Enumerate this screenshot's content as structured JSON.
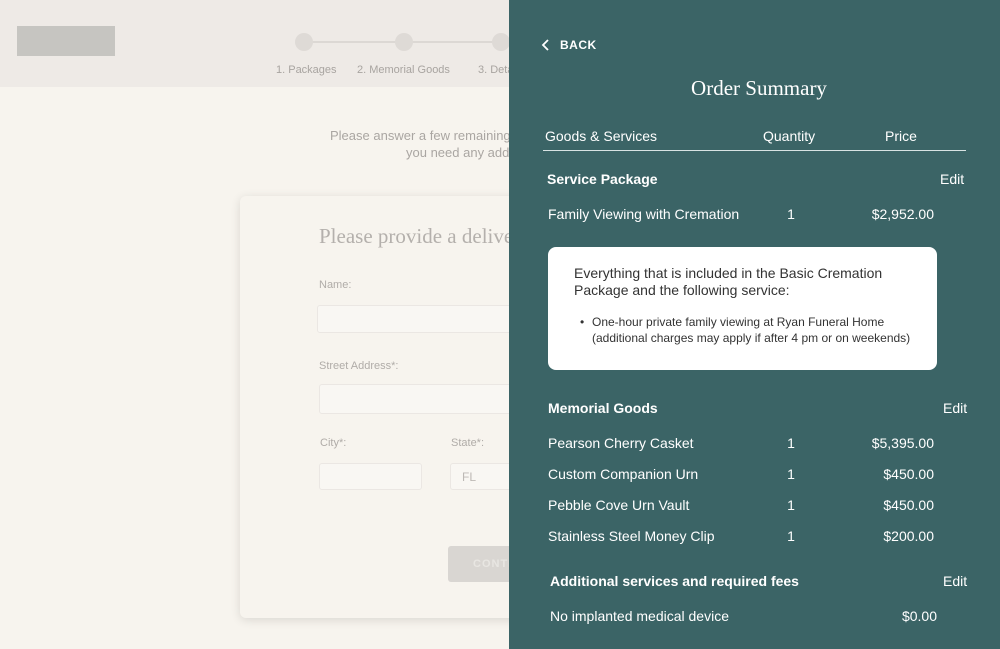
{
  "steps": [
    {
      "label": "1. Packages"
    },
    {
      "label": "2. Memorial Goods"
    },
    {
      "label": "3. Deta"
    }
  ],
  "intro": {
    "line1": "Please answer a few remaining",
    "line2": "you need any addi"
  },
  "form": {
    "title": "Please provide a delive",
    "name_label": "Name:",
    "street_label": "Street Address*:",
    "city_label": "City*:",
    "state_label": "State*:",
    "state_value": "FL",
    "continue_label": "CONTI"
  },
  "summary": {
    "back_label": "BACK",
    "title": "Order Summary",
    "headers": {
      "goods": "Goods & Services",
      "quantity": "Quantity",
      "price": "Price"
    },
    "service_package": {
      "heading": "Service Package",
      "edit": "Edit",
      "item": {
        "name": "Family Viewing with Cremation",
        "qty": "1",
        "price": "$2,952.00"
      },
      "description": {
        "line1": "Everything  that is included in the Basic Cremation",
        "line2": "Package and the following  service:",
        "bullet_line1": "One-hour private family viewing at Ryan Funeral Home",
        "bullet_line2": "(additional charges may apply if after 4 pm or on weekends)"
      }
    },
    "memorial_goods": {
      "heading": "Memorial Goods",
      "edit": "Edit",
      "items": [
        {
          "name": "Pearson Cherry Casket",
          "qty": "1",
          "price": "$5,395.00"
        },
        {
          "name": "Custom Companion Urn",
          "qty": "1",
          "price": "$450.00"
        },
        {
          "name": "Pebble Cove Urn Vault",
          "qty": "1",
          "price": "$450.00"
        },
        {
          "name": "Stainless Steel Money Clip",
          "qty": "1",
          "price": "$200.00"
        }
      ]
    },
    "additional": {
      "heading": "Additional services and required fees",
      "edit": "Edit",
      "items": [
        {
          "name": "No implanted medical device",
          "price": "$0.00"
        }
      ]
    }
  },
  "colors": {
    "panel_bg": "#3b6466",
    "page_bg": "#f7f4ee"
  }
}
